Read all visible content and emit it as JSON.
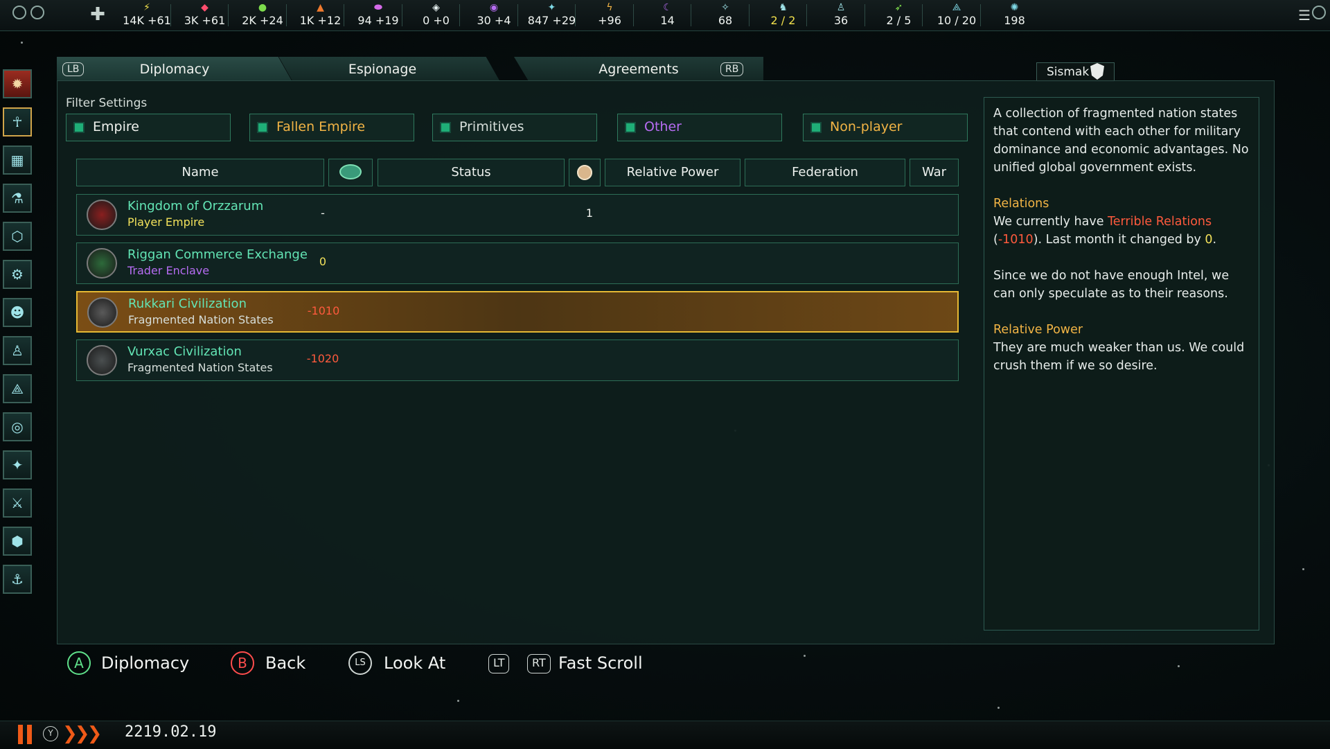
{
  "colors": {
    "accent_green": "#63e5b5",
    "gold": "#f2b445",
    "red": "#ff5a3d",
    "yellow": "#f3e25b",
    "purple": "#b66cf2",
    "orange": "#ef5a18"
  },
  "resources": [
    {
      "icon": "energy-icon",
      "value": "14K +61",
      "color": "#f2e14c"
    },
    {
      "icon": "minerals-icon",
      "value": "3K +61",
      "color": "#ff4d6d"
    },
    {
      "icon": "food-icon",
      "value": "2K +24",
      "color": "#7ddb4c"
    },
    {
      "icon": "consumer-goods-icon",
      "value": "1K +12",
      "color": "#ef7a2e"
    },
    {
      "icon": "alloys-icon",
      "value": "94 +19",
      "color": "#d46ae8"
    },
    {
      "icon": "influence-icon",
      "value": "0 +0",
      "color": "#e8f2f2"
    },
    {
      "icon": "unity-icon",
      "value": "30 +4",
      "color": "#b66cf2"
    },
    {
      "icon": "research-icon",
      "value": "847 +29",
      "color": "#7fd9e6"
    },
    {
      "icon": "amenities-icon",
      "value": "+96",
      "color": "#f2b445"
    },
    {
      "icon": "stability-icon",
      "value": "14",
      "color": "#b66cf2"
    },
    {
      "icon": "naval-icon",
      "value": "68",
      "color": "#9fe3e8"
    },
    {
      "icon": "envoys-icon",
      "value": "2 / 2",
      "color": "#9fe3e8",
      "highlight": true
    },
    {
      "icon": "pops-icon",
      "value": "36",
      "color": "#9fe3e8"
    },
    {
      "icon": "fleets-icon",
      "value": "2 / 5",
      "color": "#7ddb4c"
    },
    {
      "icon": "starbase-icon",
      "value": "10 / 20",
      "color": "#7fd9e6"
    },
    {
      "icon": "systems-icon",
      "value": "198",
      "color": "#7fd9e6"
    }
  ],
  "tabs": {
    "lb": "LB",
    "rb": "RB",
    "items": [
      {
        "label": "Diplomacy",
        "active": true
      },
      {
        "label": "Espionage",
        "active": false
      },
      {
        "label": "Agreements",
        "active": false
      }
    ]
  },
  "target_name": "Sismak",
  "filter": {
    "title": "Filter Settings",
    "items": [
      {
        "label": "Empire",
        "color": "#f0f2ee"
      },
      {
        "label": "Fallen Empire",
        "color": "#f2b445"
      },
      {
        "label": "Primitives",
        "color": "#d7dfdb"
      },
      {
        "label": "Other",
        "color": "#b66cf2"
      },
      {
        "label": "Non-player",
        "color": "#f2b445"
      }
    ]
  },
  "table": {
    "headers": {
      "name": "Name",
      "opinion_icon": "opinion-icon",
      "status": "Status",
      "relative_power_icon": "planet-icon",
      "relative_power": "Relative Power",
      "federation": "Federation",
      "war": "War"
    },
    "rows": [
      {
        "name": "Kingdom of Orzzarum",
        "type": "Player Empire",
        "type_color": "#f3e25b",
        "opinion": "-",
        "opinion_color": "#f0f2ee",
        "power": "1",
        "emblem_color": "#8a1f1f",
        "selected": false
      },
      {
        "name": "Riggan Commerce Exchange",
        "type": "Trader Enclave",
        "type_color": "#b66cf2",
        "opinion": "0",
        "opinion_color": "#f3e25b",
        "power": "",
        "emblem_color": "#2d6a3a",
        "selected": false
      },
      {
        "name": "Rukkari Civilization",
        "type": "Fragmented Nation States",
        "type_color": "#d7dfdb",
        "opinion": "-1010",
        "opinion_color": "#ff5a3d",
        "power": "",
        "emblem_color": "#5a5a5a",
        "selected": true
      },
      {
        "name": "Vurxac Civilization",
        "type": "Fragmented Nation States",
        "type_color": "#d7dfdb",
        "opinion": "-1020",
        "opinion_color": "#ff5a3d",
        "power": "",
        "emblem_color": "#4a4f50",
        "selected": false
      }
    ]
  },
  "description": {
    "intro": "A collection of fragmented nation states that contend with each other for military dominance and economic advantages. No unified global government exists.",
    "relations_heading": "Relations",
    "relations_pre": "We currently have ",
    "relations_level": "Terrible Relations",
    "relations_open": " (",
    "relations_value": "-1010",
    "relations_mid": "). Last month it changed by ",
    "relations_change": "0",
    "relations_end": ".",
    "intel_text": "Since we do not have enough Intel, we can only speculate as to their reasons.",
    "power_heading": "Relative Power",
    "power_text": "They are much weaker than us. We could crush them if we so desire."
  },
  "prompts": [
    {
      "button": "A",
      "label": "Diplomacy"
    },
    {
      "button": "B",
      "label": "Back"
    },
    {
      "button": "LS",
      "label": "Look At"
    },
    {
      "button": "LT",
      "label": ""
    },
    {
      "button": "RT",
      "label": "Fast Scroll"
    }
  ],
  "status_bar": {
    "speed_button": "Y",
    "speed_glyphs": "❯❯❯",
    "date": "2219.02.19"
  },
  "left_icons": [
    "empire-icon",
    "species-icon",
    "planets-icon",
    "research-icon",
    "market-icon",
    "contacts-icon",
    "situations-icon",
    "leaders-icon",
    "policies-icon",
    "galaxy-icon",
    "traditions-icon",
    "military-icon",
    "technology-icon",
    "fleet-icon"
  ]
}
